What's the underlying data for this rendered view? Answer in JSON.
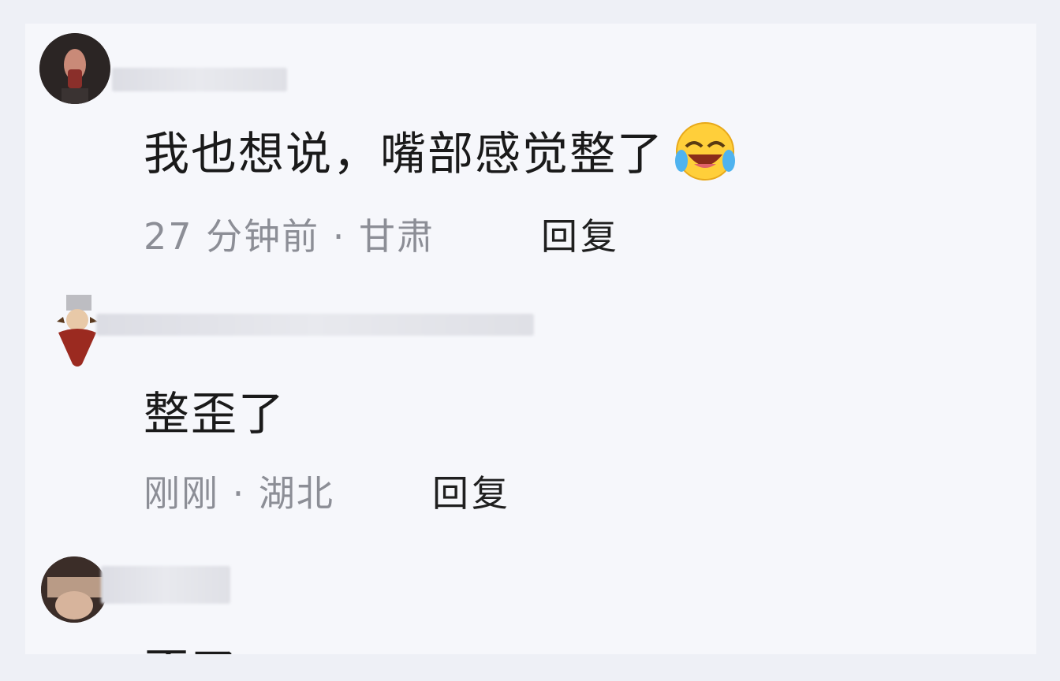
{
  "comments": [
    {
      "username": "",
      "text": "我也想说，嘴部感觉整了",
      "emoji": "laughing-crying-face-icon",
      "time": "27 分钟前",
      "separator": "·",
      "location": "甘肃",
      "reply_label": "回复"
    },
    {
      "username": "",
      "text": "整歪了",
      "time": "刚刚",
      "separator": "·",
      "location": "湖北",
      "reply_label": "回复"
    },
    {
      "username": "",
      "text": "歪了",
      "reply_label": ""
    }
  ],
  "colors": {
    "background": "#f6f7fb",
    "text_primary": "#1a1a1a",
    "text_meta": "#8c8e96"
  }
}
